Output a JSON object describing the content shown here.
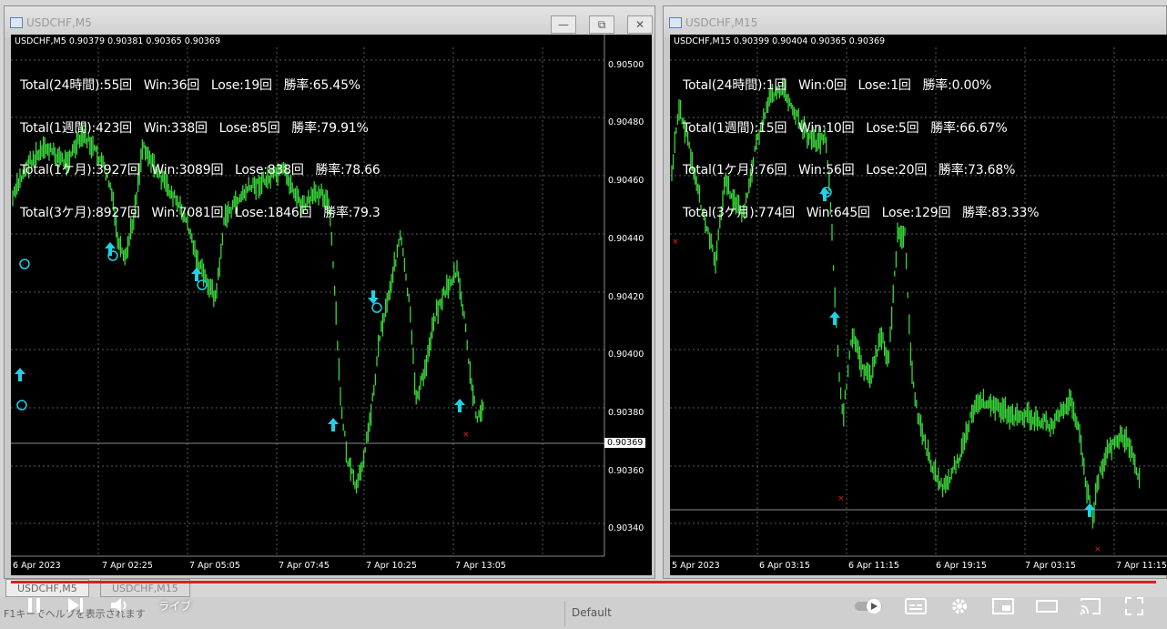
{
  "left_window": {
    "title": "USDCHF,M5",
    "symbol_line": "USDCHF,M5  0.90379 0.90381 0.90365 0.90369",
    "stats": [
      "Total(24時間):55回   Win:36回   Lose:19回   勝率:65.45%",
      "Total(1週間):423回   Win:338回   Lose:85回   勝率:79.91%",
      "Total(1ケ月):3927回   Win:3089回   Lose:838回   勝率:78.66",
      "Total(3ケ月):8927回   Win:7081回   Lose:1846回   勝率:79.3"
    ],
    "price_labels": [
      "0.90500",
      "0.90480",
      "0.90460",
      "0.90440",
      "0.90420",
      "0.90400",
      "0.90380",
      "0.90360",
      "0.90340"
    ],
    "current_price": "0.90369",
    "time_labels": [
      "6 Apr 2023",
      "7 Apr 02:25",
      "7 Apr 05:05",
      "7 Apr 07:45",
      "7 Apr 10:25",
      "7 Apr 13:05"
    ],
    "buttons": {
      "minimize": "—",
      "restore": "⧉",
      "close": "✕"
    }
  },
  "right_window": {
    "title": "USDCHF,M15",
    "symbol_line": "USDCHF,M15  0.90399 0.90404 0.90365 0.90369",
    "stats": [
      "Total(24時間):1回   Win:0回   Lose:1回   勝率:0.00%",
      "Total(1週間):15回   Win:10回   Lose:5回   勝率:66.67%",
      "Total(1ケ月):76回   Win:56回   Lose:20回   勝率:73.68%",
      "Total(3ケ月):774回   Win:645回   Lose:129回   勝率:83.33%"
    ],
    "time_labels": [
      "5 Apr 2023",
      "6 Apr 03:15",
      "6 Apr 11:15",
      "6 Apr 19:15",
      "7 Apr 03:15",
      "7 Apr 11:15"
    ]
  },
  "tabs": [
    "USDCHF,M5",
    "USDCHF,M15"
  ],
  "status": {
    "hint": "F1キーでヘルプを表示されます",
    "profile": "Default"
  },
  "player": {
    "pause_icon": "pause-icon",
    "next_icon": "next-icon",
    "volume_icon": "volume-icon",
    "live_label": "ライブ",
    "autoplay_icon": "autoplay-toggle-icon",
    "subtitles_icon": "subtitles-icon",
    "settings_icon": "gear-icon",
    "miniplayer_icon": "miniplayer-icon",
    "theater_icon": "theater-icon",
    "cast_icon": "cast-icon",
    "fullscreen_icon": "fullscreen-icon"
  },
  "colors": {
    "candles": "#39d63a",
    "arrow": "#1fd2e6",
    "loss_marker": "#e82020",
    "progress": "#d9201d",
    "chart_bg": "#000000",
    "grid": "#5a5a5a"
  }
}
